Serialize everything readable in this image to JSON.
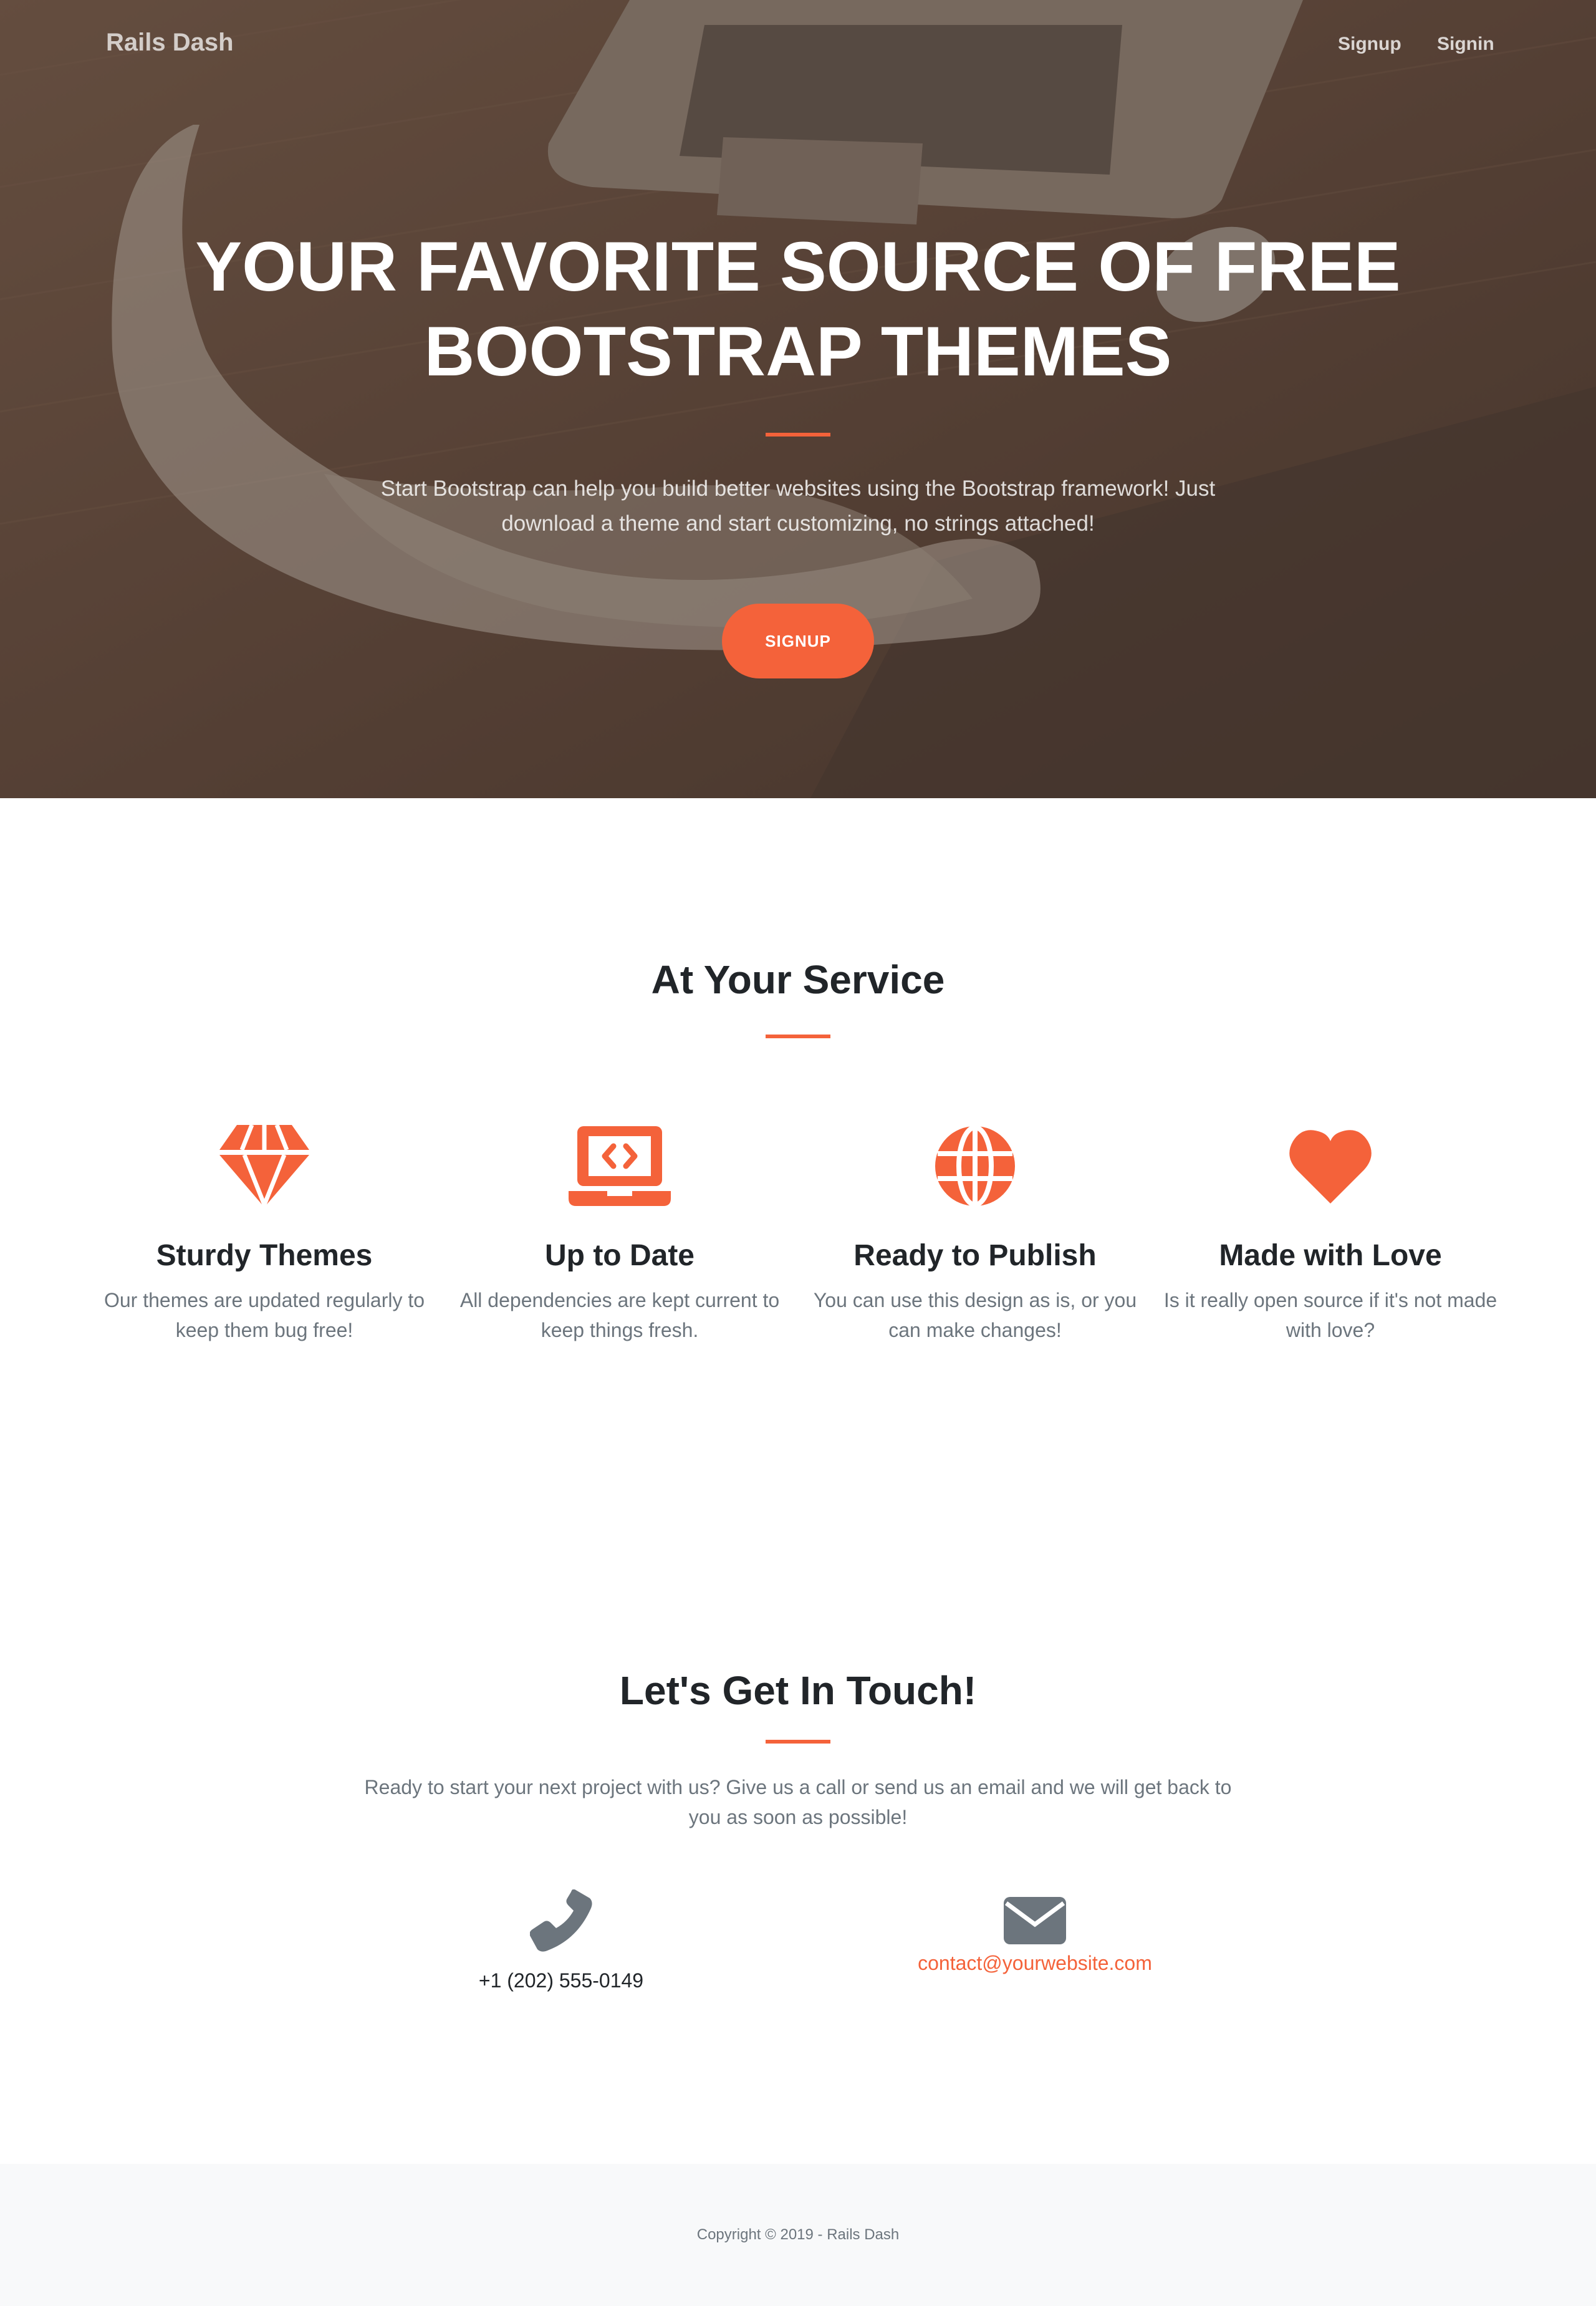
{
  "navbar": {
    "brand": "Rails Dash",
    "links": [
      {
        "label": "Signup"
      },
      {
        "label": "Signin"
      }
    ]
  },
  "hero": {
    "title_line1": "YOUR FAVORITE SOURCE OF FREE",
    "title_line2": "BOOTSTRAP THEMES",
    "subtitle": "Start Bootstrap can help you build better websites using the Bootstrap framework! Just download a theme and start customizing, no strings attached!",
    "button_label": "SIGNUP"
  },
  "services": {
    "title": "At Your Service",
    "items": [
      {
        "icon": "gem-icon",
        "title": "Sturdy Themes",
        "text": "Our themes are updated regularly to keep them bug free!"
      },
      {
        "icon": "laptop-code-icon",
        "title": "Up to Date",
        "text": "All dependencies are kept current to keep things fresh."
      },
      {
        "icon": "globe-icon",
        "title": "Ready to Publish",
        "text": "You can use this design as is, or you can make changes!"
      },
      {
        "icon": "heart-icon",
        "title": "Made with Love",
        "text": "Is it really open source if it's not made with love?"
      }
    ]
  },
  "contact": {
    "title": "Let's Get In Touch!",
    "text": "Ready to start your next project with us? Give us a call or send us an email and we will get back to you as soon as possible!",
    "phone": "+1 (202) 555-0149",
    "email": "contact@yourwebsite.com",
    "phone_icon": "phone-icon",
    "email_icon": "envelope-icon"
  },
  "footer": {
    "copyright": "Copyright © 2019 - Rails Dash"
  },
  "colors": {
    "accent": "#f4623a",
    "muted": "#6c757d",
    "heading": "#212529",
    "footer_bg": "#f8f9fa"
  }
}
